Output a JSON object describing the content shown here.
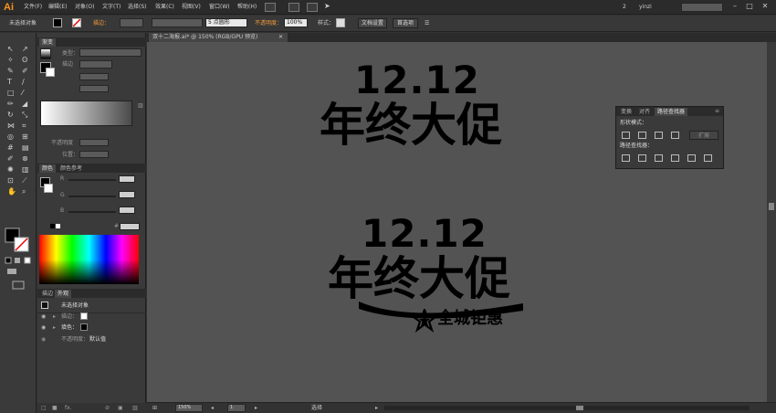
{
  "app": {
    "logo": "Ai"
  },
  "menu": {
    "items": [
      "文件(F)",
      "编辑(E)",
      "对象(O)",
      "文字(T)",
      "选择(S)",
      "效果(C)",
      "视图(V)",
      "窗口(W)",
      "帮助(H)"
    ],
    "right": {
      "workspace": "2",
      "user": "yinzi"
    }
  },
  "control": {
    "selection": "未选择对象",
    "stroke_label": "描边：",
    "brush_style": "5 点圆形",
    "opacity_label": "不透明度：",
    "opacity_value": "100%",
    "style_label": "样式：",
    "doc_setup": "文档设置",
    "preferences": "首选项"
  },
  "gradient_panel": {
    "tab": "渐变",
    "type_label": "类型：",
    "stroke_label": "描边",
    "opacity_label": "不透明度",
    "position_label": "位置："
  },
  "color_panel": {
    "tabs": [
      "颜色",
      "颜色参考"
    ],
    "channels": [
      "R",
      "G",
      "B"
    ],
    "hash": "#"
  },
  "appearance_panel": {
    "tabs": [
      "描边",
      "外观"
    ],
    "title": "未选择对象",
    "rows": [
      {
        "label": "描边："
      },
      {
        "label": "填色："
      },
      {
        "label": "不透明度：",
        "value": "默认值"
      }
    ]
  },
  "document": {
    "tab_title": "双十二海报.ai* @ 150% (RGB/GPU 预览)",
    "art1": {
      "line1": "12.12",
      "line2": "年终大促"
    },
    "art2": {
      "line1": "12.12",
      "line2": "年终大促",
      "tagline": "全城钜惠"
    }
  },
  "pathfinder": {
    "tabs": [
      "变换",
      "对齐",
      "路径查找器"
    ],
    "shape_modes": "形状模式：",
    "expand": "扩展",
    "pathfinders": "路径查找器："
  },
  "status": {
    "zoom": "150%",
    "page": "1",
    "tool": "选择"
  }
}
